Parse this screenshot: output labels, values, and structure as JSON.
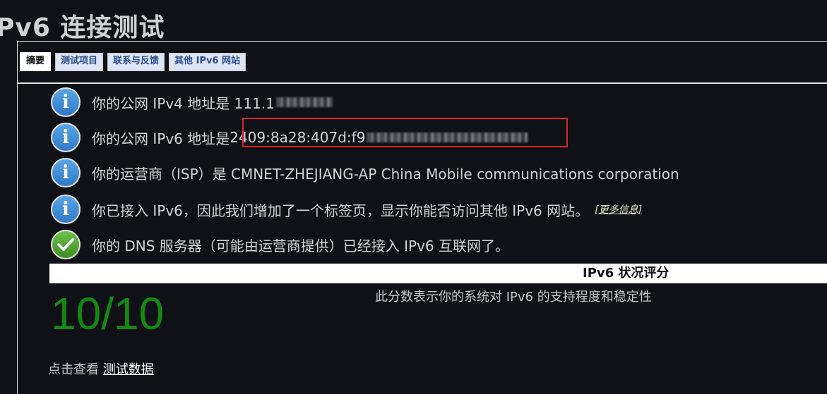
{
  "page": {
    "title": "Pv6 连接测试"
  },
  "tabs": [
    {
      "label": "摘要",
      "active": true
    },
    {
      "label": "测试项目"
    },
    {
      "label": "联系与反馈"
    },
    {
      "label": "其他 IPv6 网站"
    }
  ],
  "info": {
    "ipv4": "你的公网 IPv4 地址是 111.1",
    "ipv6_prefix": "你的公网 IPv6 地址是 ",
    "ipv6_value": "2409:8a28:407d:f9",
    "isp": "你的运营商（ISP）是 CMNET-ZHEJIANG-AP China Mobile communications corporation",
    "tab_notice": "你已接入 IPv6，因此我们增加了一个标签页，显示你能否访问其他 IPv6 网站。",
    "more_info": "[更多信息]",
    "dns": "你的 DNS 服务器（可能由运营商提供）已经接入 IPv6 互联网了。"
  },
  "score": {
    "title": "IPv6 状况评分",
    "description": "此分数表示你的系统对 IPv6 的支持程度和稳定性",
    "value": "10/10",
    "color": "#128a12"
  },
  "footer": {
    "prefix": "点击查看 ",
    "link": "测试数据"
  },
  "colors": {
    "highlight_box": "#d9262b",
    "background": "#0f1117"
  }
}
